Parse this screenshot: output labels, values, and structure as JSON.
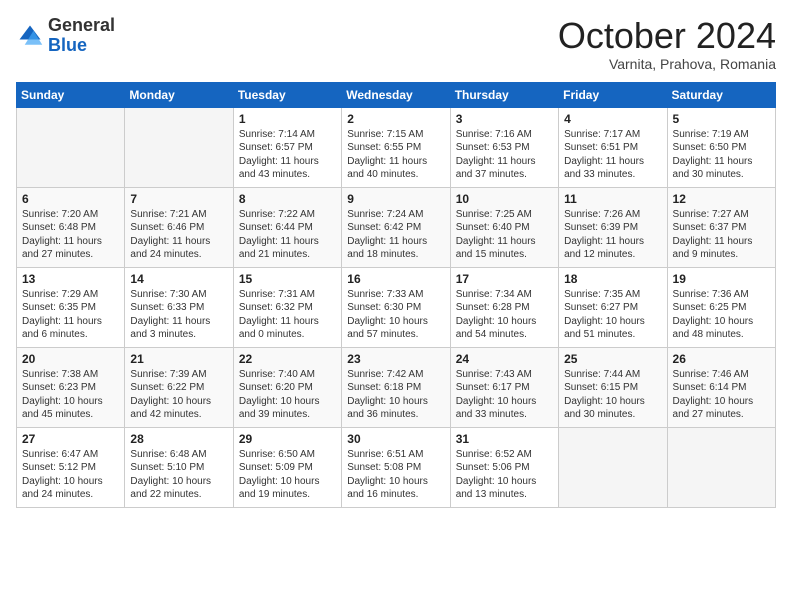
{
  "header": {
    "logo_general": "General",
    "logo_blue": "Blue",
    "month": "October 2024",
    "location": "Varnita, Prahova, Romania"
  },
  "days_of_week": [
    "Sunday",
    "Monday",
    "Tuesday",
    "Wednesday",
    "Thursday",
    "Friday",
    "Saturday"
  ],
  "weeks": [
    [
      {
        "day": "",
        "info": ""
      },
      {
        "day": "",
        "info": ""
      },
      {
        "day": "1",
        "sunrise": "Sunrise: 7:14 AM",
        "sunset": "Sunset: 6:57 PM",
        "daylight": "Daylight: 11 hours and 43 minutes."
      },
      {
        "day": "2",
        "sunrise": "Sunrise: 7:15 AM",
        "sunset": "Sunset: 6:55 PM",
        "daylight": "Daylight: 11 hours and 40 minutes."
      },
      {
        "day": "3",
        "sunrise": "Sunrise: 7:16 AM",
        "sunset": "Sunset: 6:53 PM",
        "daylight": "Daylight: 11 hours and 37 minutes."
      },
      {
        "day": "4",
        "sunrise": "Sunrise: 7:17 AM",
        "sunset": "Sunset: 6:51 PM",
        "daylight": "Daylight: 11 hours and 33 minutes."
      },
      {
        "day": "5",
        "sunrise": "Sunrise: 7:19 AM",
        "sunset": "Sunset: 6:50 PM",
        "daylight": "Daylight: 11 hours and 30 minutes."
      }
    ],
    [
      {
        "day": "6",
        "sunrise": "Sunrise: 7:20 AM",
        "sunset": "Sunset: 6:48 PM",
        "daylight": "Daylight: 11 hours and 27 minutes."
      },
      {
        "day": "7",
        "sunrise": "Sunrise: 7:21 AM",
        "sunset": "Sunset: 6:46 PM",
        "daylight": "Daylight: 11 hours and 24 minutes."
      },
      {
        "day": "8",
        "sunrise": "Sunrise: 7:22 AM",
        "sunset": "Sunset: 6:44 PM",
        "daylight": "Daylight: 11 hours and 21 minutes."
      },
      {
        "day": "9",
        "sunrise": "Sunrise: 7:24 AM",
        "sunset": "Sunset: 6:42 PM",
        "daylight": "Daylight: 11 hours and 18 minutes."
      },
      {
        "day": "10",
        "sunrise": "Sunrise: 7:25 AM",
        "sunset": "Sunset: 6:40 PM",
        "daylight": "Daylight: 11 hours and 15 minutes."
      },
      {
        "day": "11",
        "sunrise": "Sunrise: 7:26 AM",
        "sunset": "Sunset: 6:39 PM",
        "daylight": "Daylight: 11 hours and 12 minutes."
      },
      {
        "day": "12",
        "sunrise": "Sunrise: 7:27 AM",
        "sunset": "Sunset: 6:37 PM",
        "daylight": "Daylight: 11 hours and 9 minutes."
      }
    ],
    [
      {
        "day": "13",
        "sunrise": "Sunrise: 7:29 AM",
        "sunset": "Sunset: 6:35 PM",
        "daylight": "Daylight: 11 hours and 6 minutes."
      },
      {
        "day": "14",
        "sunrise": "Sunrise: 7:30 AM",
        "sunset": "Sunset: 6:33 PM",
        "daylight": "Daylight: 11 hours and 3 minutes."
      },
      {
        "day": "15",
        "sunrise": "Sunrise: 7:31 AM",
        "sunset": "Sunset: 6:32 PM",
        "daylight": "Daylight: 11 hours and 0 minutes."
      },
      {
        "day": "16",
        "sunrise": "Sunrise: 7:33 AM",
        "sunset": "Sunset: 6:30 PM",
        "daylight": "Daylight: 10 hours and 57 minutes."
      },
      {
        "day": "17",
        "sunrise": "Sunrise: 7:34 AM",
        "sunset": "Sunset: 6:28 PM",
        "daylight": "Daylight: 10 hours and 54 minutes."
      },
      {
        "day": "18",
        "sunrise": "Sunrise: 7:35 AM",
        "sunset": "Sunset: 6:27 PM",
        "daylight": "Daylight: 10 hours and 51 minutes."
      },
      {
        "day": "19",
        "sunrise": "Sunrise: 7:36 AM",
        "sunset": "Sunset: 6:25 PM",
        "daylight": "Daylight: 10 hours and 48 minutes."
      }
    ],
    [
      {
        "day": "20",
        "sunrise": "Sunrise: 7:38 AM",
        "sunset": "Sunset: 6:23 PM",
        "daylight": "Daylight: 10 hours and 45 minutes."
      },
      {
        "day": "21",
        "sunrise": "Sunrise: 7:39 AM",
        "sunset": "Sunset: 6:22 PM",
        "daylight": "Daylight: 10 hours and 42 minutes."
      },
      {
        "day": "22",
        "sunrise": "Sunrise: 7:40 AM",
        "sunset": "Sunset: 6:20 PM",
        "daylight": "Daylight: 10 hours and 39 minutes."
      },
      {
        "day": "23",
        "sunrise": "Sunrise: 7:42 AM",
        "sunset": "Sunset: 6:18 PM",
        "daylight": "Daylight: 10 hours and 36 minutes."
      },
      {
        "day": "24",
        "sunrise": "Sunrise: 7:43 AM",
        "sunset": "Sunset: 6:17 PM",
        "daylight": "Daylight: 10 hours and 33 minutes."
      },
      {
        "day": "25",
        "sunrise": "Sunrise: 7:44 AM",
        "sunset": "Sunset: 6:15 PM",
        "daylight": "Daylight: 10 hours and 30 minutes."
      },
      {
        "day": "26",
        "sunrise": "Sunrise: 7:46 AM",
        "sunset": "Sunset: 6:14 PM",
        "daylight": "Daylight: 10 hours and 27 minutes."
      }
    ],
    [
      {
        "day": "27",
        "sunrise": "Sunrise: 6:47 AM",
        "sunset": "Sunset: 5:12 PM",
        "daylight": "Daylight: 10 hours and 24 minutes."
      },
      {
        "day": "28",
        "sunrise": "Sunrise: 6:48 AM",
        "sunset": "Sunset: 5:10 PM",
        "daylight": "Daylight: 10 hours and 22 minutes."
      },
      {
        "day": "29",
        "sunrise": "Sunrise: 6:50 AM",
        "sunset": "Sunset: 5:09 PM",
        "daylight": "Daylight: 10 hours and 19 minutes."
      },
      {
        "day": "30",
        "sunrise": "Sunrise: 6:51 AM",
        "sunset": "Sunset: 5:08 PM",
        "daylight": "Daylight: 10 hours and 16 minutes."
      },
      {
        "day": "31",
        "sunrise": "Sunrise: 6:52 AM",
        "sunset": "Sunset: 5:06 PM",
        "daylight": "Daylight: 10 hours and 13 minutes."
      },
      {
        "day": "",
        "info": ""
      },
      {
        "day": "",
        "info": ""
      }
    ]
  ]
}
